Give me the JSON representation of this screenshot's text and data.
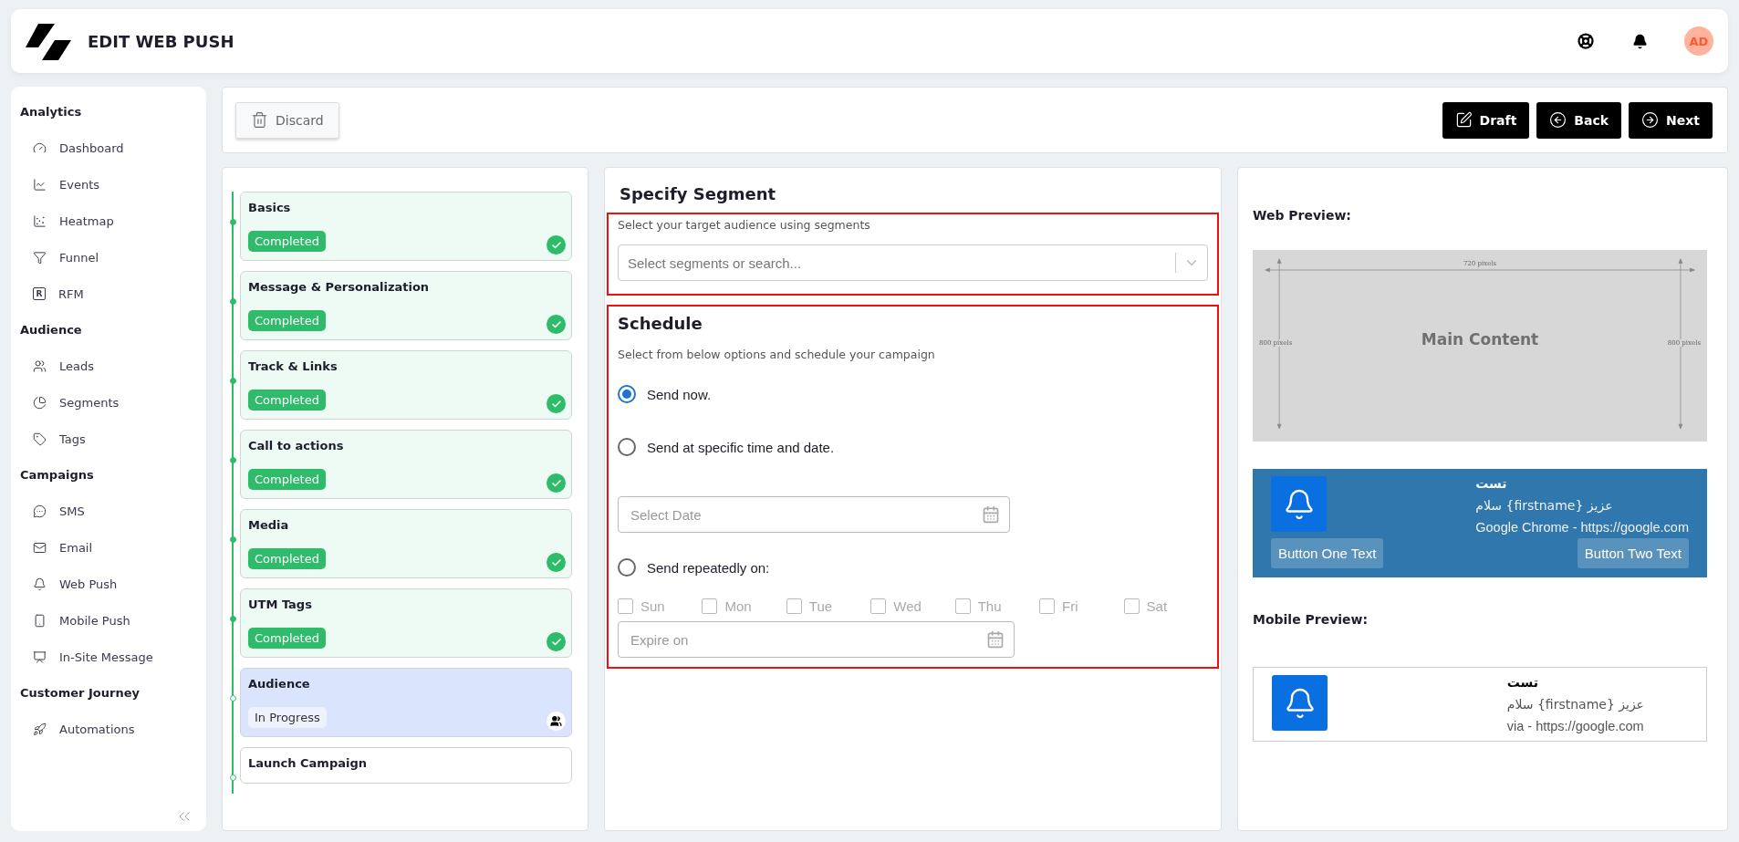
{
  "header": {
    "title": "EDIT WEB PUSH",
    "avatar": "AD"
  },
  "sidebar": {
    "sections": [
      {
        "title": "Analytics",
        "items": [
          {
            "label": "Dashboard"
          },
          {
            "label": "Events"
          },
          {
            "label": "Heatmap"
          },
          {
            "label": "Funnel"
          },
          {
            "label": "RFM",
            "icon_letter": "R"
          }
        ]
      },
      {
        "title": "Audience",
        "items": [
          {
            "label": "Leads"
          },
          {
            "label": "Segments"
          },
          {
            "label": "Tags"
          }
        ]
      },
      {
        "title": "Campaigns",
        "items": [
          {
            "label": "SMS"
          },
          {
            "label": "Email"
          },
          {
            "label": "Web Push"
          },
          {
            "label": "Mobile Push"
          },
          {
            "label": "In-Site Message"
          }
        ]
      },
      {
        "title": "Customer Journey",
        "items": [
          {
            "label": "Automations"
          }
        ]
      }
    ]
  },
  "toolbar": {
    "discard": "Discard",
    "actions": [
      {
        "label": "Draft"
      },
      {
        "label": "Back"
      },
      {
        "label": "Next"
      }
    ]
  },
  "steps": [
    {
      "title": "Basics",
      "status": "Completed",
      "kind": "completed"
    },
    {
      "title": "Message & Personalization",
      "status": "Completed",
      "kind": "completed"
    },
    {
      "title": "Track & Links",
      "status": "Completed",
      "kind": "completed"
    },
    {
      "title": "Call to actions",
      "status": "Completed",
      "kind": "completed"
    },
    {
      "title": "Media",
      "status": "Completed",
      "kind": "completed"
    },
    {
      "title": "UTM Tags",
      "status": "Completed",
      "kind": "completed"
    },
    {
      "title": "Audience",
      "status": "In Progress",
      "kind": "progress"
    },
    {
      "title": "Launch Campaign",
      "kind": "pending"
    }
  ],
  "segment": {
    "title": "Specify Segment",
    "hint": "Select your target audience using segments",
    "placeholder": "Select segments or search..."
  },
  "schedule": {
    "title": "Schedule",
    "hint": "Select from below options and schedule your campaign",
    "options": [
      {
        "label": "Send now.",
        "selected": true
      },
      {
        "label": "Send at specific time and date.",
        "selected": false
      },
      {
        "label": "Send repeatedly on:",
        "selected": false
      }
    ],
    "date_placeholder": "Select Date",
    "days": [
      {
        "label": "Sun",
        "checked": false,
        "disabled": true
      },
      {
        "label": "Mon",
        "checked": false,
        "disabled": true
      },
      {
        "label": "Tue",
        "checked": false,
        "disabled": true
      },
      {
        "label": "Wed",
        "checked": false,
        "disabled": true
      },
      {
        "label": "Thu",
        "checked": false,
        "disabled": true
      },
      {
        "label": "Fri",
        "checked": false,
        "disabled": true
      },
      {
        "label": "Sat",
        "checked": false,
        "disabled": true
      }
    ],
    "expire_placeholder": "Expire on"
  },
  "preview": {
    "web_title": "Web Preview:",
    "mockup": {
      "width_label": "720 pixels",
      "left_label": "800 pixels",
      "right_label": "800 pixels",
      "center": "Main Content"
    },
    "web_notification": {
      "title": "تست",
      "body": "عزیز {firstname} سلام",
      "source": "Google Chrome - https://google.com",
      "buttons": [
        "Button One Text",
        "Button Two Text"
      ]
    },
    "mobile_title": "Mobile Preview:",
    "mobile_notification": {
      "title": "تست",
      "body": "عزیز {firstname} سلام",
      "source": "via - https://google.com"
    }
  }
}
